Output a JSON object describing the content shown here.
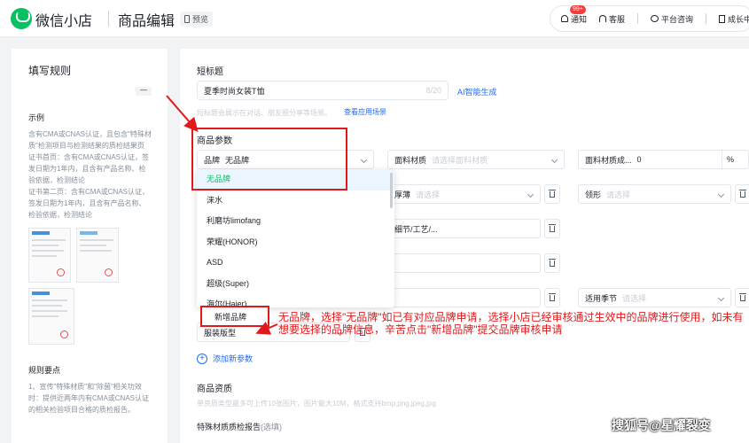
{
  "header": {
    "app_name": "微信小店",
    "page_title": "商品编辑",
    "preview_label": "预览",
    "notice_badge": "99+",
    "actions": [
      {
        "icon": "bell-icon",
        "label": "通知"
      },
      {
        "icon": "headset-icon",
        "label": "客服"
      },
      {
        "icon": "chat-icon",
        "label": "平台咨询"
      },
      {
        "icon": "book-icon",
        "label": "成长中"
      }
    ]
  },
  "left_panel": {
    "title": "填写规则",
    "collapse": "—",
    "example_title": "示例",
    "example_text": "含有CMA或CNAS认证，且包含\"特殊材质\"检测项目与检测结果的质检结果页",
    "cert_home": "证书首页：含有CMA或CNAS认证，签发日期为1年内，且含有产品名称、检验依据，检测结论",
    "cert_page2": "证书第二页：含有CMA或CNAS认证，签发日期为1年内，且含有产品名称、检验依据，检测结论",
    "rules_title": "规则要点",
    "rules_text": "1、宣传\"特殊材质\"和\"除菌\"相关功效时：提供近两年内有CMA或CNAS认证的相关检验项目合格的质检报告。"
  },
  "form": {
    "short_title_label": "短标题",
    "short_title_value": "夏季时尚女装T恤",
    "short_title_counter": "8/20",
    "ai_generate": "AI智能生成",
    "short_title_hint": "短标题会展示在对话、朋友圈分享等场景。",
    "view_scenes": "查看应用场景",
    "params_label": "商品参数",
    "brand_label": "品牌",
    "brand_value": "无品牌",
    "fabric_label": "面料材质",
    "fabric_placeholder": "请选择面料材质",
    "fabric_ratio_label": "面料材质成...",
    "fabric_ratio_value": "0",
    "fabric_ratio_unit": "%",
    "thickness_label": "厚薄",
    "thickness_placeholder": "请选择",
    "collar_label": "领形",
    "collar_placeholder": "请选择",
    "detail_label": "细节/工艺/...",
    "season_label": "适用季节",
    "season_placeholder": "请选择",
    "version_label": "服装版型",
    "add_param": "添加新参数",
    "qual_label": "商品资质",
    "qual_hint": "单资质类型最多可上传10张图片，图片最大10M，格式支持bmp,png,jpeg,jpg",
    "report_label": "特殊材质质检报告",
    "report_optional": "(选填)"
  },
  "dropdown": {
    "items": [
      "无品牌",
      "涞水",
      "利磨坊limofang",
      "荣耀(HONOR)",
      "ASD",
      "超级(Super)",
      "海尔(Haier)"
    ],
    "selected": "无品牌",
    "add_brand": "新增品牌"
  },
  "annotation": "无品牌，选择\"无品牌\"如已有对应品牌申请，选择小店已经审核通过生效中的品牌进行使用，如未有想要选择的品牌信息，辛苦点击\"新增品牌\"提交品牌审核申请",
  "watermark": "搜狐号@星耀裂变",
  "colors": {
    "brand_green": "#07c160",
    "link_blue": "#1a6aff",
    "annotation_red": "#e0191b"
  }
}
